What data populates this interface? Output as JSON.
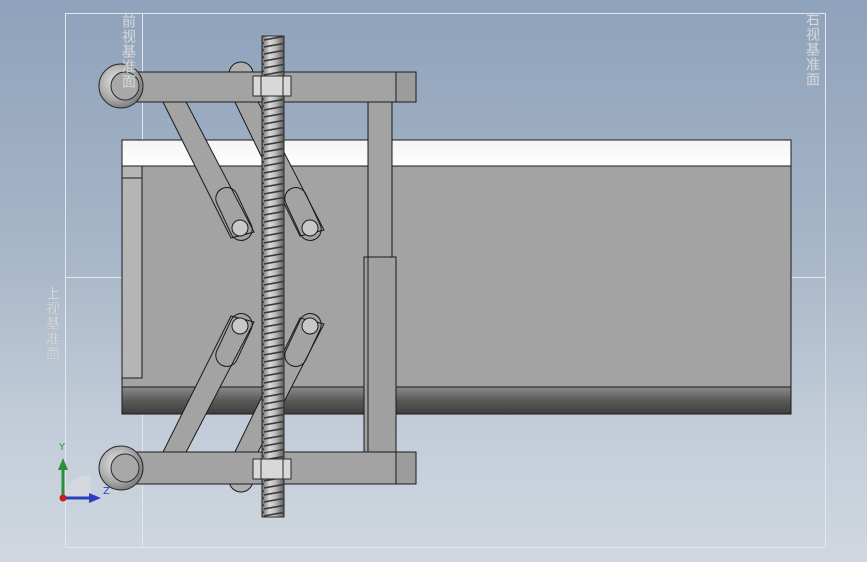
{
  "viewport": {
    "background_top": "#8fa2bb",
    "background_bottom": "#d0d7e0"
  },
  "view_labels": {
    "back": "前视基准面",
    "right": "右视基准面",
    "left": "上视基准面"
  },
  "triad": {
    "y_label": "Y",
    "z_label": "Z",
    "y_color": "#2a8f3a",
    "z_color": "#2b3fbd",
    "origin_color": "#c41e1e"
  },
  "model": {
    "part_color": "#a3a3a3",
    "edge_color": "#1a1a1a"
  }
}
